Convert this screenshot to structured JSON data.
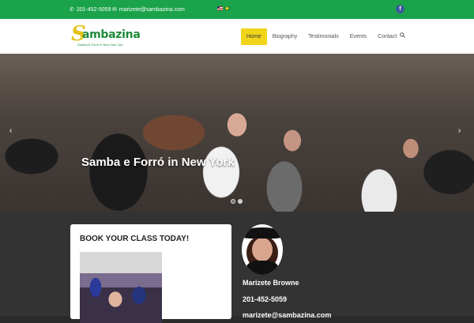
{
  "topbar": {
    "phone": "201-452-5059",
    "email": "marizete@sambazina.com",
    "social": "f"
  },
  "logo": {
    "initial": "S",
    "name": "ambazina",
    "tagline": "Samba & Forró in New York City"
  },
  "nav": {
    "items": [
      "Home",
      "Biography",
      "Testimonials",
      "Events",
      "Contact"
    ],
    "active": "Home"
  },
  "hero": {
    "title": "Samba e Forró in New York",
    "prev": "‹",
    "next": "›",
    "slides": 2,
    "active_slide": 2
  },
  "card": {
    "title": "BOOK YOUR CLASS TODAY!"
  },
  "contact": {
    "name": "Marizete Browne",
    "phone": "201-452-5059",
    "email": "marizete@sambazina.com"
  },
  "colors": {
    "topbar": "#1aa34a",
    "nav_active": "#f0d51a",
    "main_bg": "#333333"
  }
}
